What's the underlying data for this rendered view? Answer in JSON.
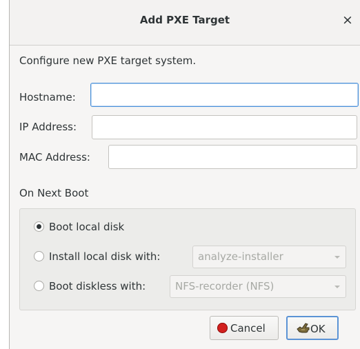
{
  "window": {
    "title": "Add PXE Target",
    "close_glyph": "×"
  },
  "intro": "Configure new PXE target system.",
  "fields": {
    "hostname": {
      "label": "Hostname:",
      "value": "",
      "placeholder": ""
    },
    "ip_address": {
      "label": "IP Address:",
      "value": "",
      "placeholder": ""
    },
    "mac_address": {
      "label": "MAC Address:",
      "value": "",
      "placeholder": ""
    }
  },
  "boot": {
    "section_label": "On Next Boot",
    "options": [
      {
        "label": "Boot local disk",
        "checked": true
      },
      {
        "label": "Install local disk with:",
        "checked": false,
        "combo_value": "analyze-installer",
        "combo_enabled": false
      },
      {
        "label": "Boot diskless with:",
        "checked": false,
        "combo_value": "NFS-recorder (NFS)",
        "combo_enabled": false
      }
    ]
  },
  "buttons": {
    "cancel": "Cancel",
    "ok": "OK"
  },
  "icons": {
    "close": "close-icon",
    "cancel": "stop-icon",
    "ok": "ok-hand-icon"
  },
  "colors": {
    "focus_border": "#4a90d9",
    "default_button_border": "#5b93d5",
    "cancel_icon": "#d2201e"
  }
}
